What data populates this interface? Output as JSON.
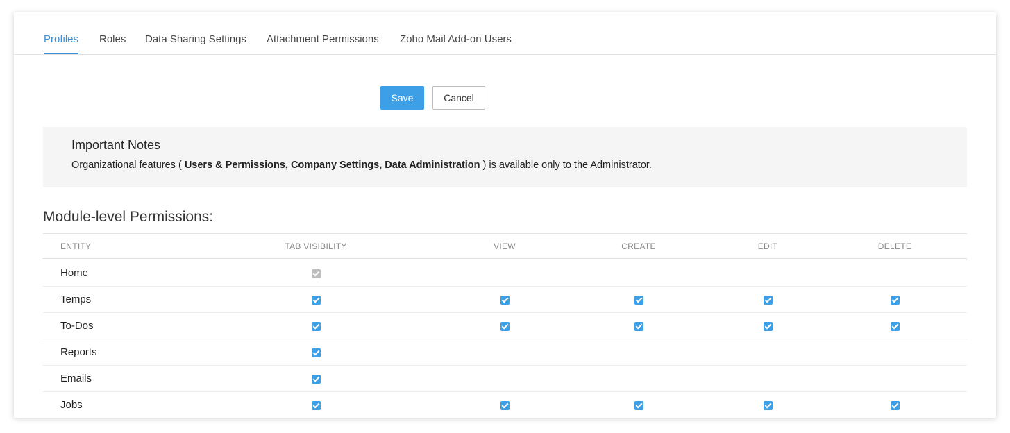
{
  "tabs": [
    {
      "label": "Profiles",
      "active": true
    },
    {
      "label": "Roles",
      "active": false
    },
    {
      "label": "Data Sharing Settings",
      "active": false
    },
    {
      "label": "Attachment Permissions",
      "active": false
    },
    {
      "label": "Zoho Mail Add-on Users",
      "active": false
    }
  ],
  "actions": {
    "save_label": "Save",
    "cancel_label": "Cancel"
  },
  "notes": {
    "title": "Important Notes",
    "text_prefix": "Organizational features ( ",
    "text_bold": "Users & Permissions, Company Settings, Data Administration",
    "text_suffix": " ) is available only to the Administrator."
  },
  "section_title": "Module-level Permissions:",
  "table": {
    "headers": [
      "ENTITY",
      "TAB VISIBILITY",
      "VIEW",
      "CREATE",
      "EDIT",
      "DELETE"
    ],
    "rows": [
      {
        "entity": "Home",
        "tab_visibility": "disabled-checked",
        "view": "none",
        "create": "none",
        "edit": "none",
        "delete": "none"
      },
      {
        "entity": "Temps",
        "tab_visibility": "checked",
        "view": "checked",
        "create": "checked",
        "edit": "checked",
        "delete": "checked"
      },
      {
        "entity": "To-Dos",
        "tab_visibility": "checked",
        "view": "checked",
        "create": "checked",
        "edit": "checked",
        "delete": "checked"
      },
      {
        "entity": "Reports",
        "tab_visibility": "checked",
        "view": "none",
        "create": "none",
        "edit": "none",
        "delete": "none"
      },
      {
        "entity": "Emails",
        "tab_visibility": "checked",
        "view": "none",
        "create": "none",
        "edit": "none",
        "delete": "none"
      },
      {
        "entity": "Jobs",
        "tab_visibility": "checked",
        "view": "checked",
        "create": "checked",
        "edit": "checked",
        "delete": "checked"
      }
    ]
  },
  "colors": {
    "accent": "#3a8ed6",
    "button": "#3d9fe5",
    "checkbox": "#3d9fe5",
    "checkbox_disabled": "#bdbdbd"
  },
  "icons": {
    "checkbox": "check-icon"
  }
}
